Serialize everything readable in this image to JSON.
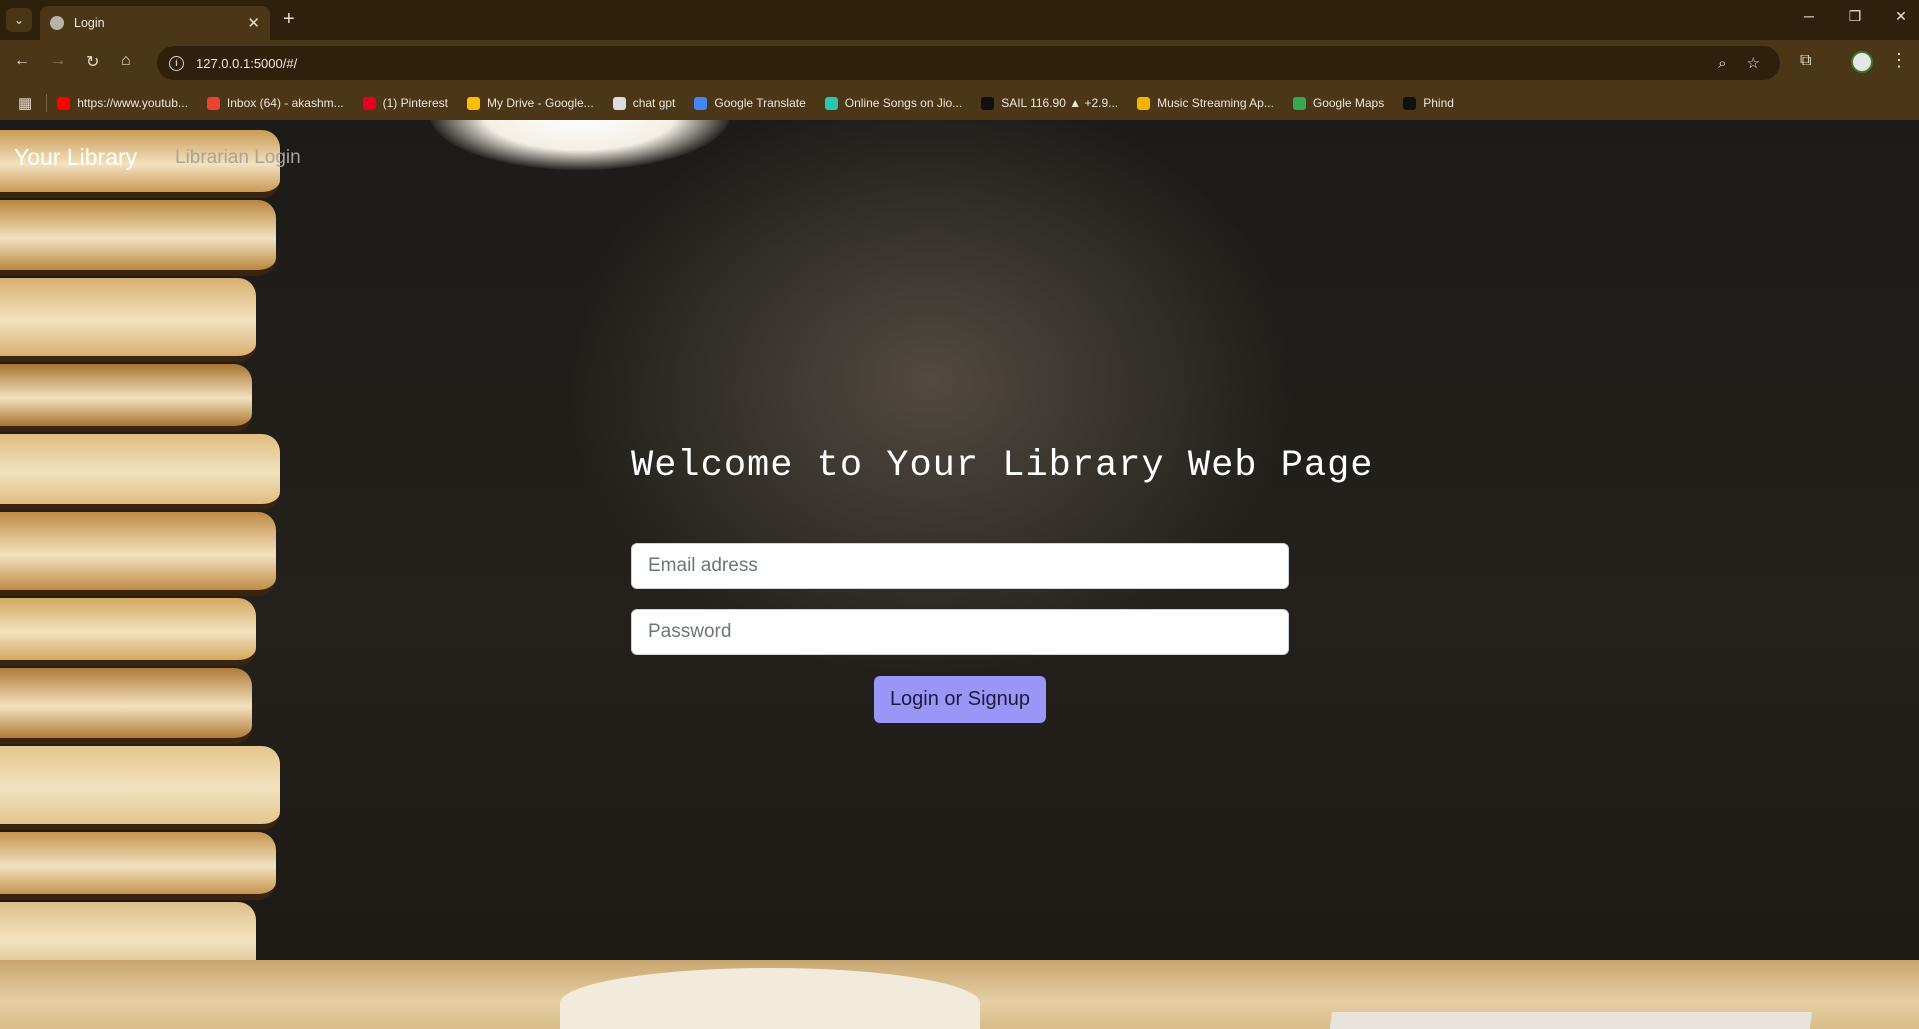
{
  "browser": {
    "tab_title": "Login",
    "url": "127.0.0.1:5000/#/",
    "bookmarks": [
      {
        "label": "https://www.youtub...",
        "color": "#ff0000"
      },
      {
        "label": "Inbox (64) - akashm...",
        "color": "#ea4335"
      },
      {
        "label": "(1) Pinterest",
        "color": "#e60023"
      },
      {
        "label": "My Drive - Google...",
        "color": "#fbbc04"
      },
      {
        "label": "chat gpt",
        "color": "#dddddd"
      },
      {
        "label": "Google Translate",
        "color": "#4285f4"
      },
      {
        "label": "Online Songs on Jio...",
        "color": "#2bc5b4"
      },
      {
        "label": "SAIL 116.90 ▲ +2.9...",
        "color": "#111111"
      },
      {
        "label": "Music Streaming Ap...",
        "color": "#f4b400"
      },
      {
        "label": "Google Maps",
        "color": "#34a853"
      },
      {
        "label": "Phind",
        "color": "#111111"
      }
    ]
  },
  "navbar": {
    "brand": "Your Library",
    "librarian_link": "Librarian Login"
  },
  "main": {
    "heading": "Welcome to Your Library Web Page",
    "email_placeholder": "Email adress",
    "password_placeholder": "Password",
    "submit_label": "Login or Signup"
  },
  "colors": {
    "button_bg": "#9a96f7",
    "page_bg": "#1d1b18"
  }
}
